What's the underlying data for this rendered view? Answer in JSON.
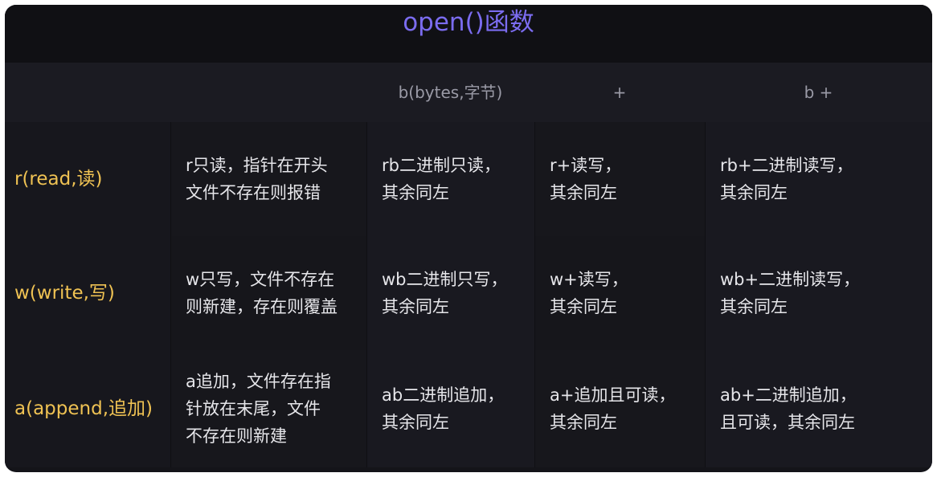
{
  "title": "open()函数",
  "header": {
    "c0": "",
    "c1": "",
    "c2": "b(bytes,字节)",
    "c3": "+",
    "c4": "b +"
  },
  "rows": [
    {
      "label": "r(read,读)",
      "c1": "r只读，指针在开头\n文件不存在则报错",
      "c2": "rb二进制只读，\n其余同左",
      "c3": "r+读写，\n其余同左",
      "c4": "rb+二进制读写，\n其余同左"
    },
    {
      "label": "w(write,写)",
      "c1": "w只写，文件不存在\n则新建，存在则覆盖",
      "c2": "wb二进制只写，\n其余同左",
      "c3": "w+读写，\n其余同左",
      "c4": "wb+二进制读写，\n其余同左"
    },
    {
      "label": "a(append,追加)",
      "c1": "a追加，文件存在指\n针放在末尾，文件\n不存在则新建",
      "c2": "ab二进制追加，\n其余同左",
      "c3": "a+追加且可读，\n其余同左",
      "c4": "ab+二进制追加，\n且可读，其余同左"
    }
  ]
}
